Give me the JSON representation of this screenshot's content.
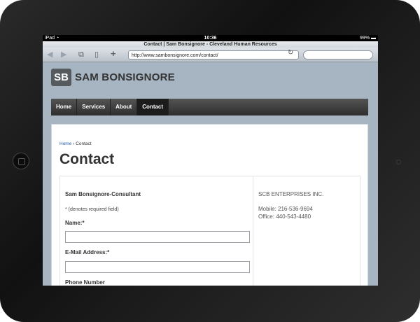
{
  "status": {
    "device": "iPad",
    "time": "10:36",
    "battery": "99%"
  },
  "browser": {
    "page_title": "Contact | Sam Bonsignore - Cleveland Human Resources",
    "url": "http://www.sambonsignore.com/contact/"
  },
  "site": {
    "logo_mark": "SB",
    "logo_text": "SAM BONSIGNORE",
    "nav": [
      "Home",
      "Services",
      "About",
      "Contact"
    ],
    "active_nav": "Contact"
  },
  "breadcrumb": {
    "home": "Home",
    "separator": "›",
    "current": "Contact"
  },
  "page": {
    "title": "Contact"
  },
  "form": {
    "heading": "Sam Bonsignore-Consultant",
    "required_note": "* (denotes required field)",
    "name_label": "Name:*",
    "email_label": "E-Mail Address:*",
    "phone_label": "Phone Number"
  },
  "company": {
    "name": "SCB ENTERPRISES INC.",
    "mobile": "Mobile: 216-536-9694",
    "office": "Office: 440-543-4480"
  }
}
